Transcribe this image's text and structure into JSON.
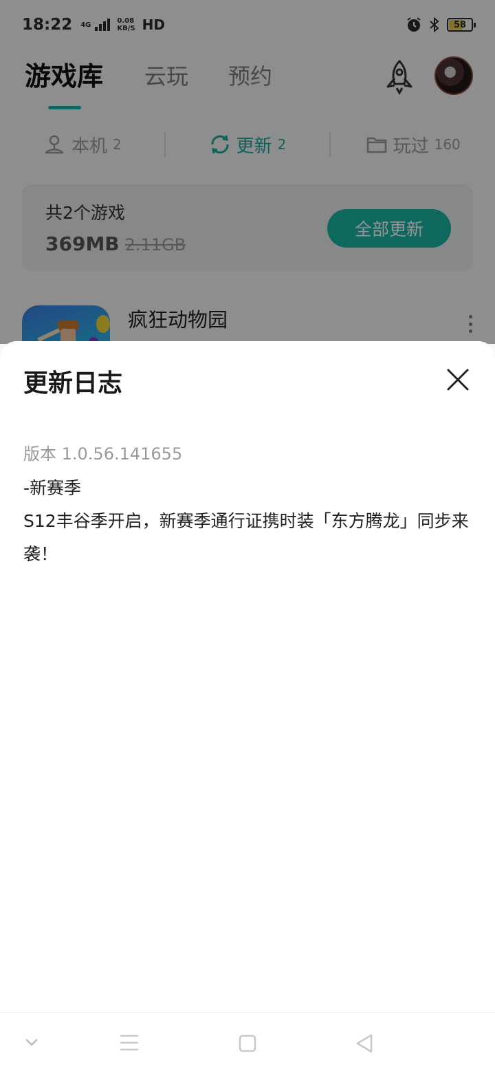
{
  "status_bar": {
    "time": "18:22",
    "network_type": "4G",
    "speed_value": "0.08",
    "speed_unit": "KB/S",
    "hd_label": "HD",
    "battery": "58"
  },
  "header": {
    "tabs": [
      {
        "label": "游戏库",
        "active": true
      },
      {
        "label": "云玩",
        "active": false
      },
      {
        "label": "预约",
        "active": false
      }
    ]
  },
  "sub_tabs": [
    {
      "label": "本机",
      "count": "2",
      "icon": "person-icon",
      "active": false
    },
    {
      "label": "更新",
      "count": "2",
      "icon": "refresh-icon",
      "active": true
    },
    {
      "label": "玩过",
      "count": "160",
      "icon": "folder-icon",
      "active": false
    }
  ],
  "summary": {
    "total_label": "共2个游戏",
    "size": "369MB",
    "original_size": "2.11GB",
    "update_all_label": "全部更新"
  },
  "game_list": [
    {
      "name": "疯狂动物园"
    }
  ],
  "update_log": {
    "title": "更新日志",
    "version": "版本 1.0.56.141655",
    "line1": "-新赛季",
    "line2": "S12丰谷季开启，新赛季通行证携时装「东方腾龙」同步来袭！"
  },
  "colors": {
    "accent": "#1bb3a3",
    "overlay": "rgba(0,0,0,0.42)"
  },
  "icons": {
    "rocket": "rocket-icon",
    "avatar": "avatar",
    "close": "close-icon",
    "nav_down": "chevron-down-icon",
    "nav_menu": "menu-icon",
    "nav_home": "square-home-icon",
    "nav_back": "triangle-back-icon"
  }
}
